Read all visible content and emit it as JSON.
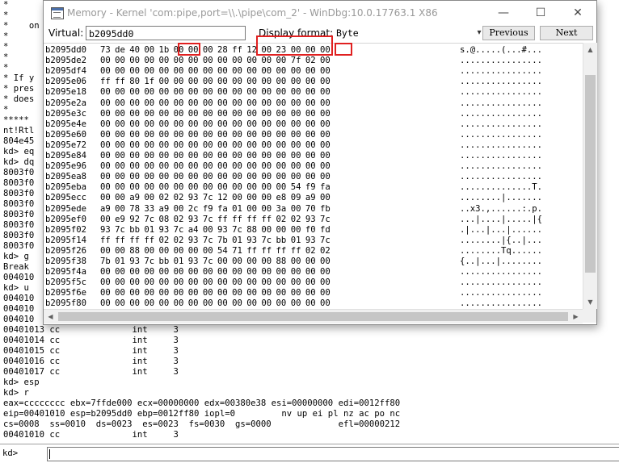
{
  "background": {
    "lines": [
      "*    ",
      "*",
      "*    on",
      "*",
      "*",
      "*",
      "*",
      "* If y",
      "* pres",
      "* does",
      "*",
      "*****",
      "nt!Rtl",
      "804e45",
      "kd> eq",
      "kd> dq",
      "8003f0",
      "8003f0",
      "8003f0",
      "8003f0",
      "8003f0",
      "8003f0",
      "8003f0",
      "8003f0",
      "kd> g",
      "Break",
      "004010",
      "kd> u",
      "004010",
      "004010",
      "004010",
      "00401013 cc              int     3",
      "00401014 cc              int     3",
      "00401015 cc              int     3",
      "00401016 cc              int     3",
      "00401017 cc              int     3",
      "kd> esp",
      "kd> r",
      "eax=cccccccc ebx=7ffde000 ecx=00000000 edx=00380e38 esi=00000000 edi=0012ff80",
      "eip=00401010 esp=b2095dd0 ebp=0012ff80 iopl=0         nv up ei pl nz ac po nc",
      "cs=0008  ss=0010  ds=0023  es=0023  fs=0030  gs=0000             efl=00000212",
      "00401010 cc              int     3"
    ]
  },
  "command": {
    "prompt": "kd>",
    "value": ""
  },
  "memory_window": {
    "title": "Memory - Kernel 'com:pipe,port=\\\\.\\pipe\\com_2' - WinDbg:10.0.17763.1 X86",
    "virtual_label": "Virtual:",
    "virtual_value": "b2095dd0",
    "display_format_label": "Display format:",
    "display_format_value": "Byte",
    "previous_label": "Previous",
    "next_label": "Next",
    "window_controls": {
      "minimize": "—",
      "maximize": "☐",
      "close": "✕"
    },
    "highlight_color": "#e02020",
    "rows": [
      {
        "addr": "b2095dd0",
        "bytes": [
          "73",
          "de",
          "40",
          "00",
          "1b",
          "00",
          "00",
          "00",
          "28",
          "ff",
          "12",
          "00",
          "23",
          "00",
          "00",
          "00"
        ],
        "ascii": "s.@.....(...#..."
      },
      {
        "addr": "b2095de2",
        "bytes": [
          "00",
          "00",
          "00",
          "00",
          "00",
          "00",
          "00",
          "00",
          "00",
          "00",
          "00",
          "00",
          "00",
          "7f",
          "02",
          "00"
        ],
        "ascii": "................"
      },
      {
        "addr": "b2095df4",
        "bytes": [
          "00",
          "00",
          "00",
          "00",
          "00",
          "00",
          "00",
          "00",
          "00",
          "00",
          "00",
          "00",
          "00",
          "00",
          "00",
          "00"
        ],
        "ascii": "................"
      },
      {
        "addr": "b2095e06",
        "bytes": [
          "ff",
          "ff",
          "80",
          "1f",
          "00",
          "00",
          "00",
          "00",
          "00",
          "00",
          "00",
          "00",
          "00",
          "00",
          "00",
          "00"
        ],
        "ascii": "................"
      },
      {
        "addr": "b2095e18",
        "bytes": [
          "00",
          "00",
          "00",
          "00",
          "00",
          "00",
          "00",
          "00",
          "00",
          "00",
          "00",
          "00",
          "00",
          "00",
          "00",
          "00"
        ],
        "ascii": "................"
      },
      {
        "addr": "b2095e2a",
        "bytes": [
          "00",
          "00",
          "00",
          "00",
          "00",
          "00",
          "00",
          "00",
          "00",
          "00",
          "00",
          "00",
          "00",
          "00",
          "00",
          "00"
        ],
        "ascii": "................"
      },
      {
        "addr": "b2095e3c",
        "bytes": [
          "00",
          "00",
          "00",
          "00",
          "00",
          "00",
          "00",
          "00",
          "00",
          "00",
          "00",
          "00",
          "00",
          "00",
          "00",
          "00"
        ],
        "ascii": "................"
      },
      {
        "addr": "b2095e4e",
        "bytes": [
          "00",
          "00",
          "00",
          "00",
          "00",
          "00",
          "00",
          "00",
          "00",
          "00",
          "00",
          "00",
          "00",
          "00",
          "00",
          "00"
        ],
        "ascii": "................"
      },
      {
        "addr": "b2095e60",
        "bytes": [
          "00",
          "00",
          "00",
          "00",
          "00",
          "00",
          "00",
          "00",
          "00",
          "00",
          "00",
          "00",
          "00",
          "00",
          "00",
          "00"
        ],
        "ascii": "................"
      },
      {
        "addr": "b2095e72",
        "bytes": [
          "00",
          "00",
          "00",
          "00",
          "00",
          "00",
          "00",
          "00",
          "00",
          "00",
          "00",
          "00",
          "00",
          "00",
          "00",
          "00"
        ],
        "ascii": "................"
      },
      {
        "addr": "b2095e84",
        "bytes": [
          "00",
          "00",
          "00",
          "00",
          "00",
          "00",
          "00",
          "00",
          "00",
          "00",
          "00",
          "00",
          "00",
          "00",
          "00",
          "00"
        ],
        "ascii": "................"
      },
      {
        "addr": "b2095e96",
        "bytes": [
          "00",
          "00",
          "00",
          "00",
          "00",
          "00",
          "00",
          "00",
          "00",
          "00",
          "00",
          "00",
          "00",
          "00",
          "00",
          "00"
        ],
        "ascii": "................"
      },
      {
        "addr": "b2095ea8",
        "bytes": [
          "00",
          "00",
          "00",
          "00",
          "00",
          "00",
          "00",
          "00",
          "00",
          "00",
          "00",
          "00",
          "00",
          "00",
          "00",
          "00"
        ],
        "ascii": "................"
      },
      {
        "addr": "b2095eba",
        "bytes": [
          "00",
          "00",
          "00",
          "00",
          "00",
          "00",
          "00",
          "00",
          "00",
          "00",
          "00",
          "00",
          "00",
          "54",
          "f9",
          "fa",
          "01"
        ],
        "ascii": "..............T."
      },
      {
        "addr": "b2095ecc",
        "bytes": [
          "00",
          "00",
          "a9",
          "00",
          "02",
          "02",
          "93",
          "7c",
          "12",
          "00",
          "00",
          "00",
          "e8",
          "09",
          "a9",
          "00",
          "00"
        ],
        "ascii": "........|......."
      },
      {
        "addr": "b2095ede",
        "bytes": [
          "a9",
          "00",
          "78",
          "33",
          "a9",
          "00",
          "2c",
          "f9",
          "fa",
          "01",
          "00",
          "00",
          "3a",
          "00",
          "70",
          "fb",
          "fa",
          "01"
        ],
        "ascii": "..x3.,......:.p.."
      },
      {
        "addr": "b2095ef0",
        "bytes": [
          "00",
          "e9",
          "92",
          "7c",
          "08",
          "02",
          "93",
          "7c",
          "ff",
          "ff",
          "ff",
          "ff",
          "02",
          "02",
          "93",
          "7c",
          "7b",
          "01"
        ],
        "ascii": "...|....|.....|{."
      },
      {
        "addr": "b2095f02",
        "bytes": [
          "93",
          "7c",
          "bb",
          "01",
          "93",
          "7c",
          "a4",
          "00",
          "93",
          "7c",
          "88",
          "00",
          "00",
          "00",
          "f0",
          "fd",
          "7f"
        ],
        "ascii": ".|...|...|......."
      },
      {
        "addr": "b2095f14",
        "bytes": [
          "ff",
          "ff",
          "ff",
          "ff",
          "02",
          "02",
          "93",
          "7c",
          "7b",
          "01",
          "93",
          "7c",
          "bb",
          "01",
          "93",
          "7c",
          "00",
          "00"
        ],
        "ascii": "........|{..|...|."
      },
      {
        "addr": "b2095f26",
        "bytes": [
          "00",
          "00",
          "88",
          "00",
          "00",
          "00",
          "00",
          "00",
          "54",
          "71",
          "ff",
          "ff",
          "ff",
          "ff",
          "02",
          "02",
          "93",
          "7c"
        ],
        "ascii": "........Tq........"
      },
      {
        "addr": "b2095f38",
        "bytes": [
          "7b",
          "01",
          "93",
          "7c",
          "bb",
          "01",
          "93",
          "7c",
          "00",
          "00",
          "00",
          "00",
          "88",
          "00",
          "00",
          "00",
          "00"
        ],
        "ascii": "{..|...|........."
      },
      {
        "addr": "b2095f4a",
        "bytes": [
          "00",
          "00",
          "00",
          "00",
          "00",
          "00",
          "00",
          "00",
          "00",
          "00",
          "00",
          "00",
          "00",
          "00",
          "00",
          "00"
        ],
        "ascii": "................"
      },
      {
        "addr": "b2095f5c",
        "bytes": [
          "00",
          "00",
          "00",
          "00",
          "00",
          "00",
          "00",
          "00",
          "00",
          "00",
          "00",
          "00",
          "00",
          "00",
          "00",
          "00"
        ],
        "ascii": "................"
      },
      {
        "addr": "b2095f6e",
        "bytes": [
          "00",
          "00",
          "00",
          "00",
          "00",
          "00",
          "00",
          "00",
          "00",
          "00",
          "00",
          "00",
          "00",
          "00",
          "00",
          "00"
        ],
        "ascii": "................"
      },
      {
        "addr": "b2095f80",
        "bytes": [
          "00",
          "00",
          "00",
          "00",
          "00",
          "00",
          "00",
          "00",
          "00",
          "00",
          "00",
          "00",
          "00",
          "00",
          "00",
          "00"
        ],
        "ascii": "................"
      }
    ]
  }
}
